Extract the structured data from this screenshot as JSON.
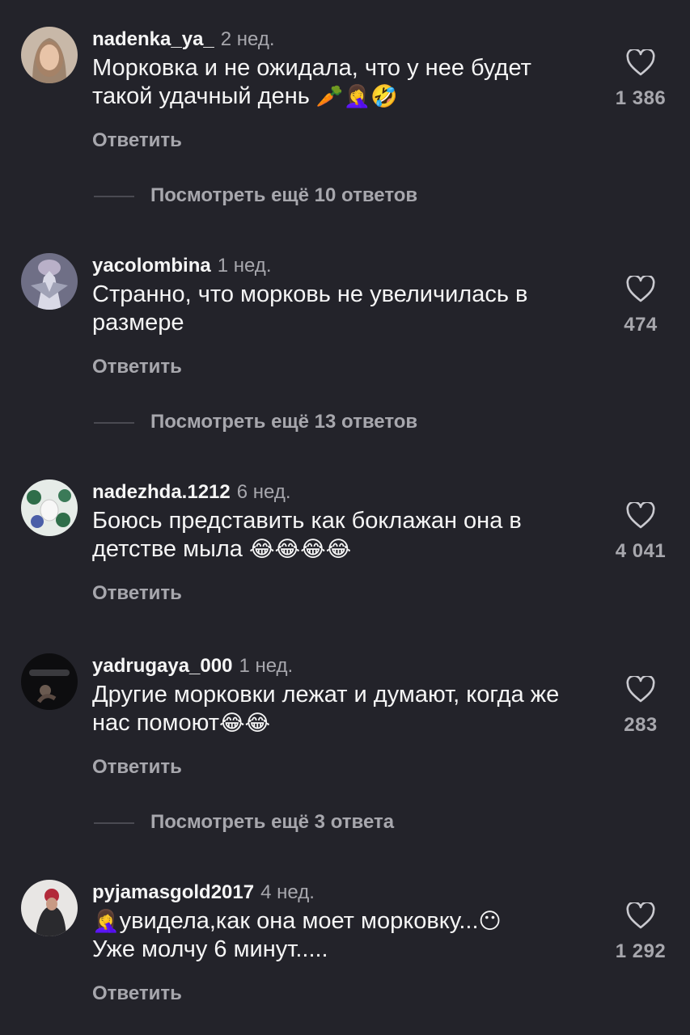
{
  "reply_label": "Ответить",
  "comments": [
    {
      "user": "nadenka_ya_",
      "time": "2 нед.",
      "text": "Морковка и не ожидала, что у нее будет такой удачный день",
      "emoji": "🥕🤦‍♀️🤣",
      "likes": "1 386",
      "more": "Посмотреть ещё 10 ответов"
    },
    {
      "user": "yacolombina",
      "time": "1 нед.",
      "text": "Странно, что морковь не увеличилась в размере",
      "emoji": "",
      "likes": "474",
      "more": "Посмотреть ещё 13 ответов"
    },
    {
      "user": "nadezhda.1212",
      "time": "6 нед.",
      "text": "Боюсь представить как боклажан она в детстве мыла",
      "emoji": "😂😂😂😂",
      "likes": "4 041",
      "more": ""
    },
    {
      "user": "yadrugaya_000",
      "time": "1 нед.",
      "text": "Другие морковки лежат и думают, когда же нас помоют",
      "emoji": "😂😂",
      "likes": "283",
      "more": "Посмотреть ещё 3 ответа"
    },
    {
      "user": "pyjamasgold2017",
      "time": "4 нед.",
      "text_prefix_emoji": "🤦‍♀️",
      "text": "увидела,как она моет морковку...",
      "emoji": "😶",
      "text2": "Уже молчу 6 минут.....",
      "likes": "1 292",
      "more": ""
    }
  ],
  "icons": {
    "like": "heart-outline-icon"
  },
  "colors": {
    "background": "#23232a",
    "secondary_text": "#a7a7ad"
  }
}
